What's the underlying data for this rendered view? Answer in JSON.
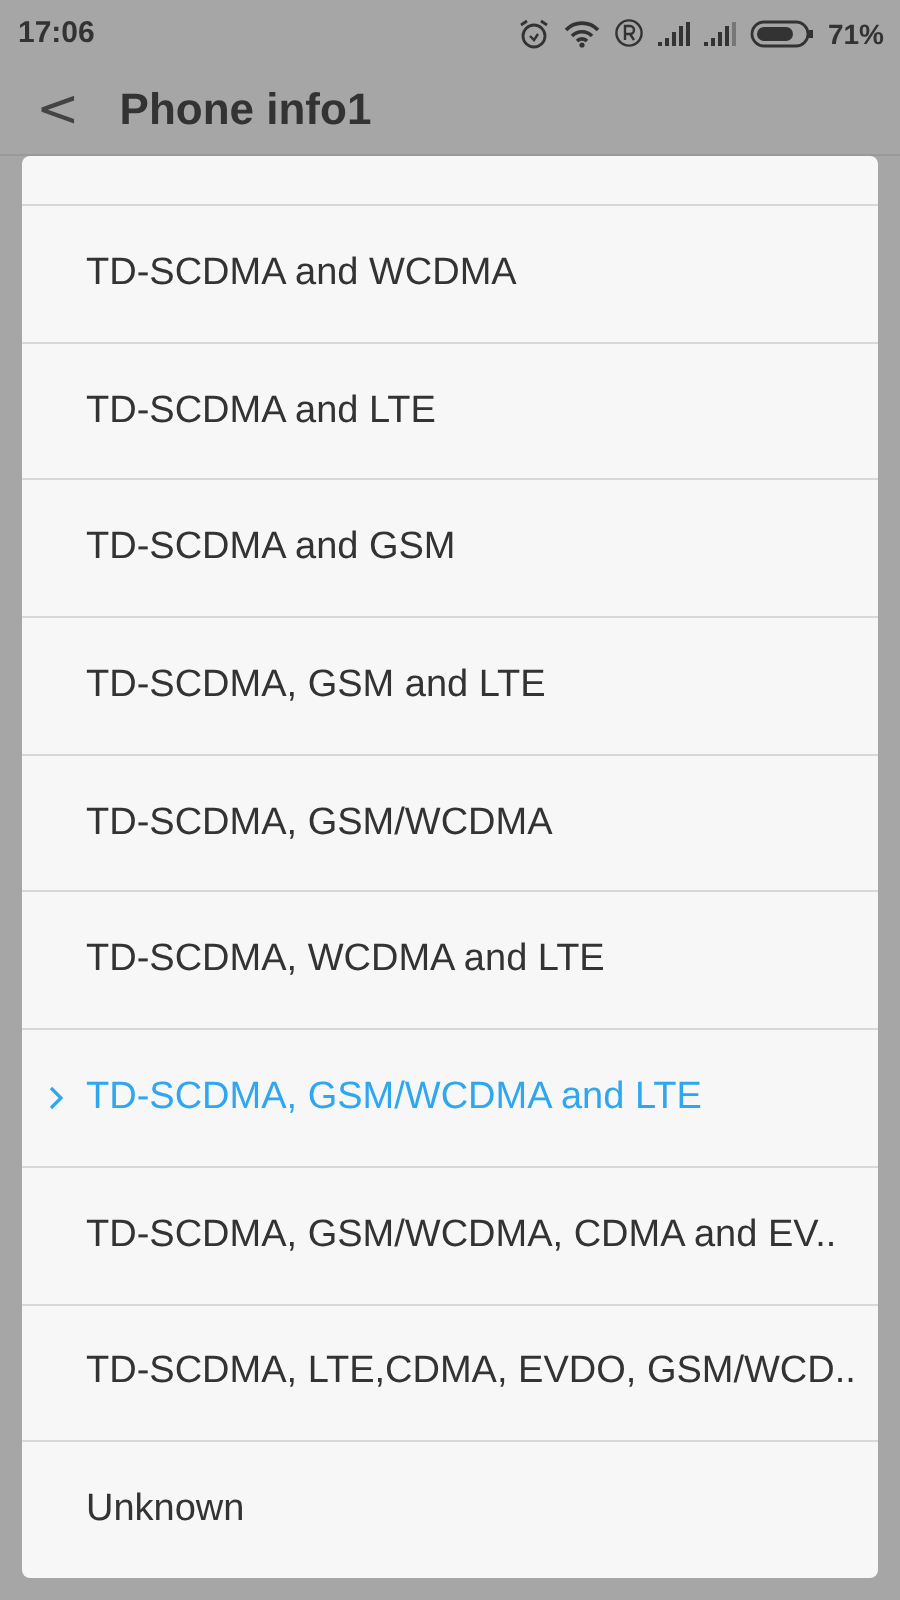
{
  "status_bar": {
    "time": "17:06",
    "battery_text": "71%"
  },
  "toolbar": {
    "back": "<",
    "title": "Phone info1"
  },
  "dialog": {
    "options": [
      {
        "label": "TD-SCDMA and WCDMA",
        "selected": false
      },
      {
        "label": "TD-SCDMA and LTE",
        "selected": false
      },
      {
        "label": "TD-SCDMA and GSM",
        "selected": false
      },
      {
        "label": "TD-SCDMA, GSM and LTE",
        "selected": false
      },
      {
        "label": "TD-SCDMA, GSM/WCDMA",
        "selected": false
      },
      {
        "label": "TD-SCDMA, WCDMA and LTE",
        "selected": false
      },
      {
        "label": "TD-SCDMA, GSM/WCDMA and LTE",
        "selected": true
      },
      {
        "label": "TD-SCDMA, GSM/WCDMA, CDMA and EV..",
        "selected": false
      },
      {
        "label": "TD-SCDMA, LTE,CDMA, EVDO, GSM/WCD..",
        "selected": false
      },
      {
        "label": "Unknown",
        "selected": false
      }
    ]
  }
}
